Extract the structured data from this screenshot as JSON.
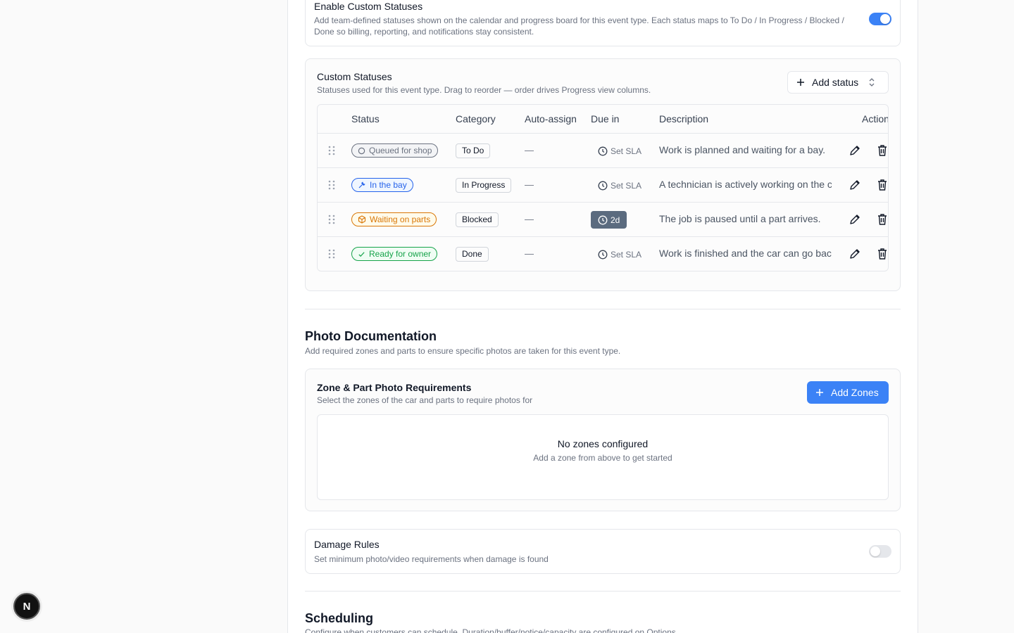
{
  "enable_custom_statuses": {
    "title": "Enable Custom Statuses",
    "description": "Add team-defined statuses shown on the calendar and progress board for this event type. Each status maps to To Do / In Progress / Blocked / Done so billing, reporting, and notifications stay consistent.",
    "enabled": true
  },
  "custom_statuses": {
    "title": "Custom Statuses",
    "description": "Statuses used for this event type. Drag to reorder — order drives Progress view columns.",
    "add_button": "Add status",
    "columns": [
      "Status",
      "Category",
      "Auto-assign",
      "Due in",
      "Description",
      "Actions"
    ],
    "rows": [
      {
        "status": "Queued for shop",
        "icon": "circle-icon",
        "color": "#6b7280",
        "category": "To Do",
        "auto_assign": "—",
        "due": "Set SLA",
        "due_set": false,
        "description": "Work is planned and waiting for a bay."
      },
      {
        "status": "In the bay",
        "icon": "wrench-icon",
        "color": "#2563eb",
        "category": "In Progress",
        "auto_assign": "—",
        "due": "Set SLA",
        "due_set": false,
        "description": "A technician is actively working on the car."
      },
      {
        "status": "Waiting on parts",
        "icon": "package-icon",
        "color": "#d97706",
        "category": "Blocked",
        "auto_assign": "—",
        "due": "2d",
        "due_set": true,
        "description": "The job is paused until a part arrives."
      },
      {
        "status": "Ready for owner",
        "icon": "check-icon",
        "color": "#16a34a",
        "category": "Done",
        "auto_assign": "—",
        "due": "Set SLA",
        "due_set": false,
        "description": "Work is finished and the car can go back."
      }
    ]
  },
  "photo_documentation": {
    "title": "Photo Documentation",
    "description": "Add required zones and parts to ensure specific photos are taken for this event type.",
    "card_title": "Zone & Part Photo Requirements",
    "card_description": "Select the zones of the car and parts to require photos for",
    "add_button": "Add Zones",
    "empty_title": "No zones configured",
    "empty_description": "Add a zone from above to get started"
  },
  "damage_rules": {
    "title": "Damage Rules",
    "description": "Set minimum photo/video requirements when damage is found",
    "enabled": false
  },
  "scheduling": {
    "title": "Scheduling",
    "description": "Configure when customers can schedule. Duration/buffer/notice/capacity are configured on Options."
  },
  "fab": {
    "label": "N"
  },
  "colors": {
    "accent": "#3b82f6",
    "sla_filled": "#5b6b7f"
  }
}
